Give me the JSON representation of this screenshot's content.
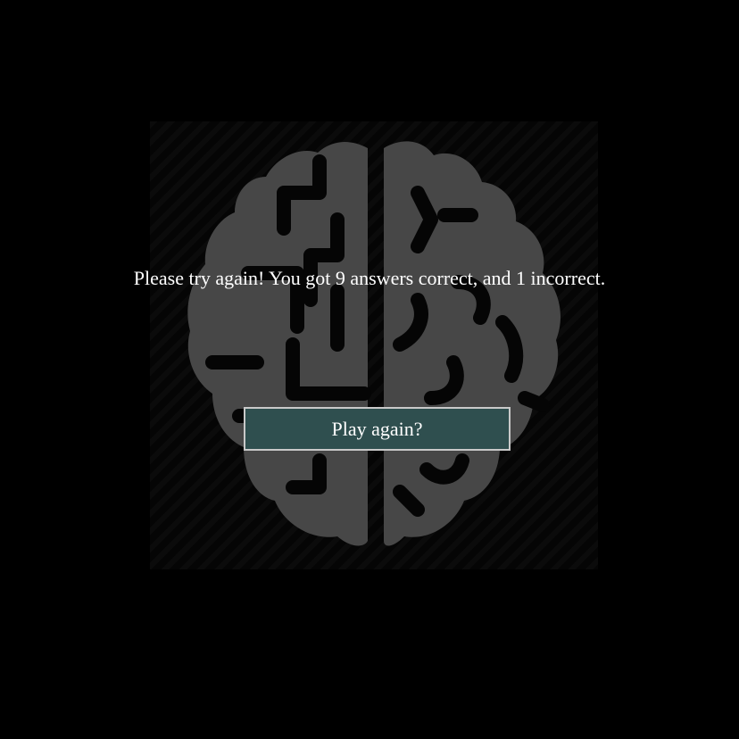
{
  "background_color": "#000000",
  "brain_color": "#474747",
  "button_color": "#2f4f4f",
  "illustration": {
    "icon": "brain-icon"
  },
  "result": {
    "message": "Please try again! You got 9 answers correct, and 1 incorrect."
  },
  "actions": {
    "play_again_label": "Play again?"
  }
}
